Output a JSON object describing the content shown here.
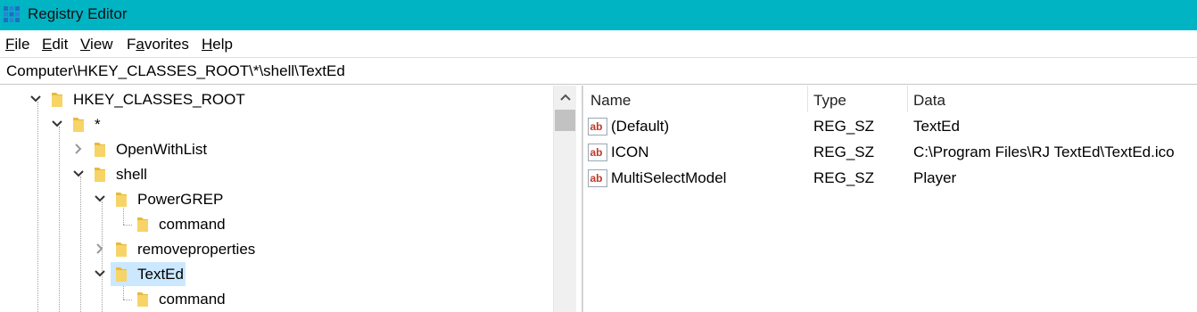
{
  "window": {
    "title": "Registry Editor",
    "app_icon": "registry-editor-icon"
  },
  "menu": [
    {
      "pre": "",
      "key": "F",
      "post": "ile"
    },
    {
      "pre": "",
      "key": "E",
      "post": "dit"
    },
    {
      "pre": "",
      "key": "V",
      "post": "iew"
    },
    {
      "pre": "F",
      "key": "a",
      "post": "vorites"
    },
    {
      "pre": "",
      "key": "H",
      "post": "elp"
    }
  ],
  "address": "Computer\\HKEY_CLASSES_ROOT\\*\\shell\\TextEd",
  "tree": [
    {
      "label": "HKEY_CLASSES_ROOT",
      "state": "expanded"
    },
    {
      "label": "*",
      "state": "expanded"
    },
    {
      "label": "OpenWithList",
      "state": "collapsed"
    },
    {
      "label": "shell",
      "state": "expanded"
    },
    {
      "label": "PowerGREP",
      "state": "expanded"
    },
    {
      "label": "command",
      "state": "leaf"
    },
    {
      "label": "removeproperties",
      "state": "collapsed"
    },
    {
      "label": "TextEd",
      "state": "expanded",
      "selected": true
    },
    {
      "label": "command",
      "state": "leaf"
    }
  ],
  "columns": {
    "name": "Name",
    "type": "Type",
    "data": "Data"
  },
  "values": [
    {
      "name": "(Default)",
      "type": "REG_SZ",
      "data": "TextEd"
    },
    {
      "name": "ICON",
      "type": "REG_SZ",
      "data": "C:\\Program Files\\RJ TextEd\\TextEd.ico"
    },
    {
      "name": "MultiSelectModel",
      "type": "REG_SZ",
      "data": "Player"
    }
  ],
  "colors": {
    "titlebar": "#00b4c4",
    "selection": "#cce8ff",
    "folder": "#e8b93a",
    "value_icon": "#c0392b"
  }
}
